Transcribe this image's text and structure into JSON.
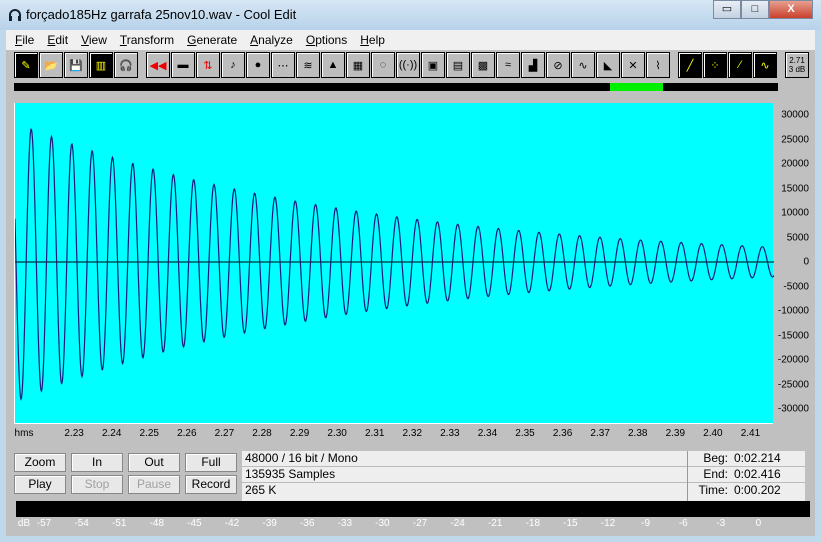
{
  "window": {
    "title": "forçado185Hz garrafa 25nov10.wav - Cool Edit",
    "minimize": "▭",
    "maximize": "□",
    "close": "X"
  },
  "menu": [
    {
      "label": "File",
      "u": "F",
      "rest": "ile"
    },
    {
      "label": "Edit",
      "u": "E",
      "rest": "dit"
    },
    {
      "label": "View",
      "u": "V",
      "rest": "iew"
    },
    {
      "label": "Transform",
      "u": "T",
      "rest": "ransform"
    },
    {
      "label": "Generate",
      "u": "G",
      "rest": "enerate"
    },
    {
      "label": "Analyze",
      "u": "A",
      "rest": "nalyze"
    },
    {
      "label": "Options",
      "u": "O",
      "rest": "ptions"
    },
    {
      "label": "Help",
      "u": "H",
      "rest": "elp"
    }
  ],
  "toolbar": {
    "icons": [
      "new-icon",
      "open-icon",
      "save-icon",
      "save-selection-icon",
      "headphones-icon",
      "|",
      "reverse-icon",
      "silence-icon",
      "invert-icon",
      "pitch-icon",
      "amplify-icon",
      "delay-icon",
      "echo-icon",
      "envelope-icon",
      "noise-reduction-icon",
      "flanger-icon",
      "reverb-icon",
      "filter-icon",
      "fft-filter-icon",
      "quick-filter-icon",
      "distortion-icon",
      "dynamics-icon",
      "stretch-icon",
      "clip-restore-icon",
      "wave-icon",
      "noise-gen-icon",
      "stereo-field-icon",
      "|",
      "tone-gen-icon",
      "generate-noise-icon",
      "generate-dtmf-icon",
      "generate-tones-icon",
      "|"
    ],
    "level_label_top": "2.71",
    "level_label_bottom": "3 dB"
  },
  "overview": {
    "view_start_fraction": 0.78,
    "view_end_fraction": 0.85
  },
  "waveform": {
    "background": "#00ffff",
    "line_color": "#1a1a80",
    "y_ticks": [
      "30000",
      "25000",
      "20000",
      "15000",
      "10000",
      "5000",
      "0",
      "-5000",
      "-10000",
      "-15000",
      "-20000",
      "-25000",
      "-30000"
    ],
    "x_unit": "hms",
    "x_ticks": [
      "2.23",
      "2.24",
      "2.25",
      "2.26",
      "2.27",
      "2.28",
      "2.29",
      "2.30",
      "2.31",
      "2.32",
      "2.33",
      "2.34",
      "2.35",
      "2.36",
      "2.37",
      "2.38",
      "2.39",
      "2.40",
      "2.41"
    ]
  },
  "controls": {
    "zoom": "Zoom",
    "in": "In",
    "out": "Out",
    "full": "Full",
    "play": "Play",
    "stop": "Stop",
    "pause": "Pause",
    "record": "Record"
  },
  "info": {
    "format": "48000 / 16 bit / Mono",
    "samples": "135935 Samples",
    "size": "265 K"
  },
  "selection": {
    "beg_label": "Beg:",
    "beg": "0:02.214",
    "end_label": "End:",
    "end": "0:02.416",
    "time_label": "Time:",
    "time": "0:00.202"
  },
  "meter": {
    "labels": [
      "dB",
      "-57",
      "-54",
      "-51",
      "-48",
      "-45",
      "-42",
      "-39",
      "-36",
      "-33",
      "-30",
      "-27",
      "-24",
      "-21",
      "-18",
      "-15",
      "-12",
      "-9",
      "-6",
      "-3",
      "0"
    ]
  }
}
